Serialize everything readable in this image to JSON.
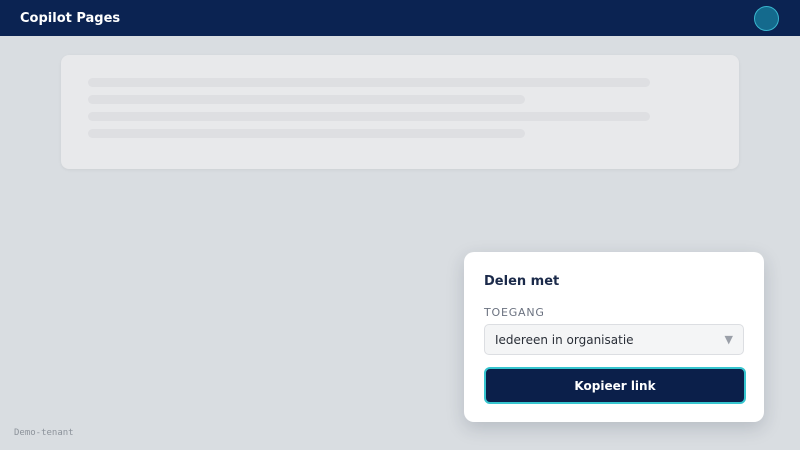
{
  "header": {
    "app_title": "Copilot Pages",
    "avatar_icon": "user-avatar-icon"
  },
  "footer": {
    "tenant": "Demo-tenant"
  },
  "share_panel": {
    "title": "Delen met",
    "access_label": "TOEGANG",
    "access_value": "Iedereen in organisatie",
    "caret": "▼",
    "copy_label": "Kopieer link"
  },
  "colors": {
    "topbar": "#0b2352",
    "accent_focus": "#36c5cf",
    "button": "#0b1f4a",
    "background": "#d9dde1"
  }
}
